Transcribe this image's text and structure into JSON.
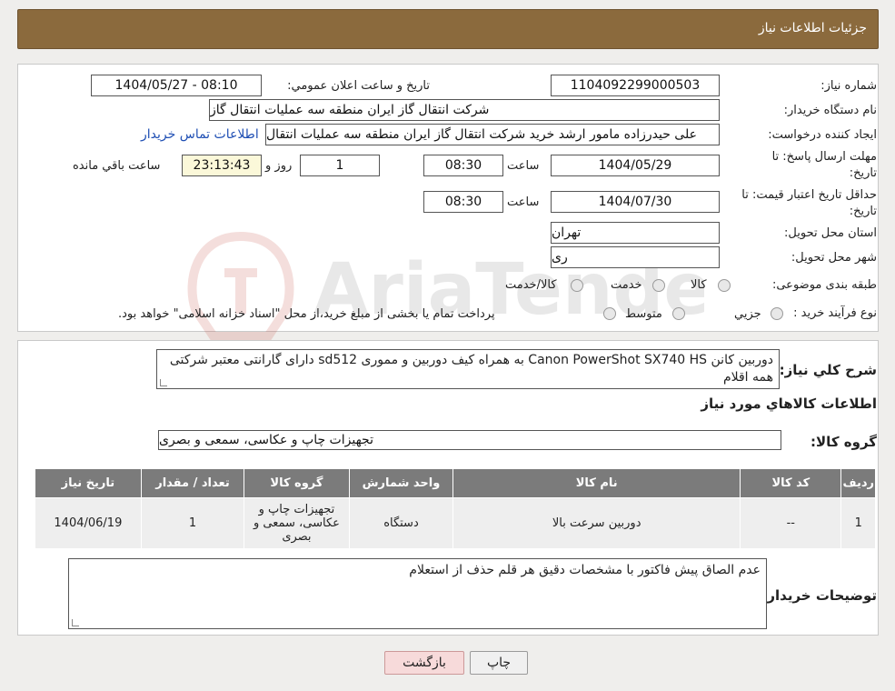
{
  "header": {
    "title": "جزئيات اطلاعات نياز"
  },
  "fields": {
    "need_number_label": "شماره نياز:",
    "need_number": "1104092299000503",
    "announce_label": "تاريخ و ساعت اعلان عمومي:",
    "announce_value": "1404/05/27 - 08:10",
    "buyer_org_label": "نام دستگاه خريدار:",
    "buyer_org": "شركت انتقال گاز ايران منطقه سه عمليات انتقال گاز",
    "creator_label": "ايجاد کننده درخواست:",
    "creator": "علی حیدرزاده مامور ارشد خرید شرکت انتقال گاز ایران منطقه سه عملیات انتقال",
    "contact_link": "اطلاعات تماس خريدار",
    "deadline_label_1": "مهلت ارسال پاسخ: تا",
    "deadline_label_2": "تاريخ:",
    "deadline_date": "1404/05/29",
    "time_label": "ساعت",
    "deadline_time": "08:30",
    "days_value": "1",
    "days_label": "روز و",
    "remaining_value": "23:13:43",
    "remaining_label": "ساعت باقي مانده",
    "validity_label_1": "حداقل تاريخ اعتبار قيمت: تا",
    "validity_label_2": "تاريخ:",
    "validity_date": "1404/07/30",
    "validity_time": "08:30",
    "province_label": "استان محل تحويل:",
    "province": "تهران",
    "city_label": "شهر محل تحويل:",
    "city": "ری",
    "category_label": "طبقه بندی موضوعی:",
    "category_options": [
      "کالا",
      "خدمت",
      "کالا/خدمت"
    ],
    "process_label": "نوع فرآيند خريد :",
    "process_options": [
      "جزيي",
      "متوسط"
    ],
    "process_note": "پرداخت تمام يا بخشی از مبلغ خريد،از محل \"اسناد خزانه اسلامی\" خواهد بود."
  },
  "description": {
    "label": "شرح کلي نياز:",
    "text": "دوربین کانن Canon PowerShot SX740 HS به همراه کیف دوربین و مموری sd512 دارای گارانتی معتبر شرکتی همه اقلام"
  },
  "goods": {
    "section_title": "اطلاعات کالاهاي مورد نياز",
    "group_label": "گروه کالا:",
    "group_value": "تجهيزات چاپ و عکاسی، سمعی و بصری",
    "table": {
      "headers": [
        "رديف",
        "کد کالا",
        "نام کالا",
        "واحد شمارش",
        "گروه کالا",
        "تعداد / مقدار",
        "تاريخ نياز"
      ],
      "rows": [
        [
          "1",
          "--",
          "دوربین سرعت بالا",
          "دستگاه",
          "تجهيزات چاپ و عکاسی، سمعی و بصری",
          "1",
          "1404/06/19"
        ]
      ]
    }
  },
  "buyer_notes": {
    "label": "توضيحات خريدار:",
    "text": "عدم الصاق پیش فاکتور با مشخصات دقیق هر قلم حذف از استعلام"
  },
  "buttons": {
    "print": "چاپ",
    "back": "بازگشت"
  },
  "watermark_text": "AriaTender.neT",
  "colors": {
    "header_bg": "#8b6a3d",
    "table_header": "#7b7b7b",
    "remaining_bg": "#fbf8d9",
    "back_bg": "#f7dada"
  }
}
